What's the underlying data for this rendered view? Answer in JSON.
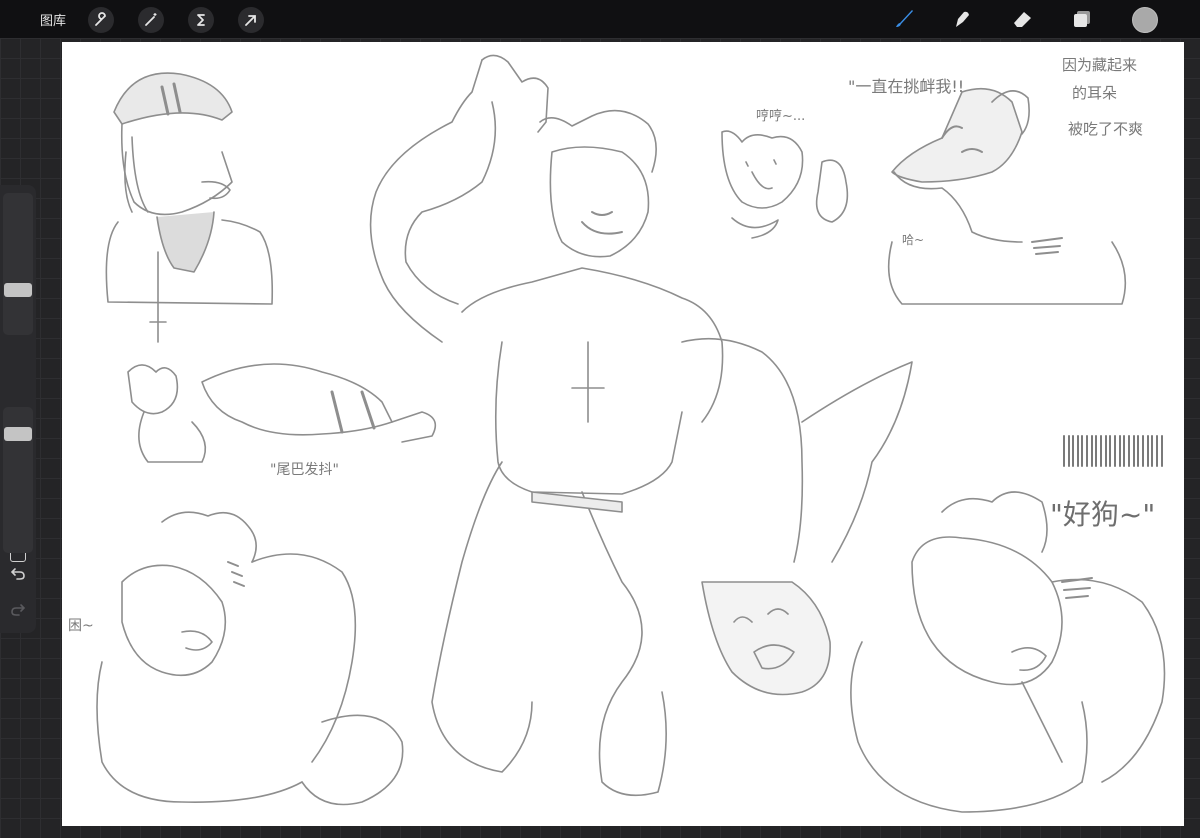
{
  "toolbar": {
    "gallery_label": "图库",
    "left_tools": [
      {
        "icon": "wrench-icon",
        "name": "actions"
      },
      {
        "icon": "magic-wand-icon",
        "name": "adjustments"
      },
      {
        "icon": "selection-s-icon",
        "name": "selection"
      },
      {
        "icon": "transform-arrow-icon",
        "name": "transform"
      }
    ],
    "right_tools": [
      {
        "icon": "brush-icon",
        "name": "paint",
        "active": true
      },
      {
        "icon": "smudge-icon",
        "name": "smudge"
      },
      {
        "icon": "eraser-icon",
        "name": "erase"
      },
      {
        "icon": "layers-icon",
        "name": "layers"
      }
    ],
    "current_color": "#a9a9a9",
    "active_color": "#3a8ee6"
  },
  "sidebar": {
    "brush_size": 0.3,
    "brush_opacity": 0.85,
    "modify_icon": "square-icon",
    "undo_icon": "undo-icon",
    "redo_icon": "redo-icon"
  },
  "canvas": {
    "notes": {
      "top_center_left": "\"一直在挑衅我!!",
      "top_right_1": "因为藏起来",
      "top_right_2": "的耳朵",
      "top_right_3": "被吃了不爽",
      "small_head": "哼哼~...",
      "tail_caption": "\"尾巴发抖\"",
      "good_dog": "\"好狗~\"",
      "left_bottom": "困~",
      "right_head": "哈~"
    },
    "line_color": "#8e8e8e"
  }
}
